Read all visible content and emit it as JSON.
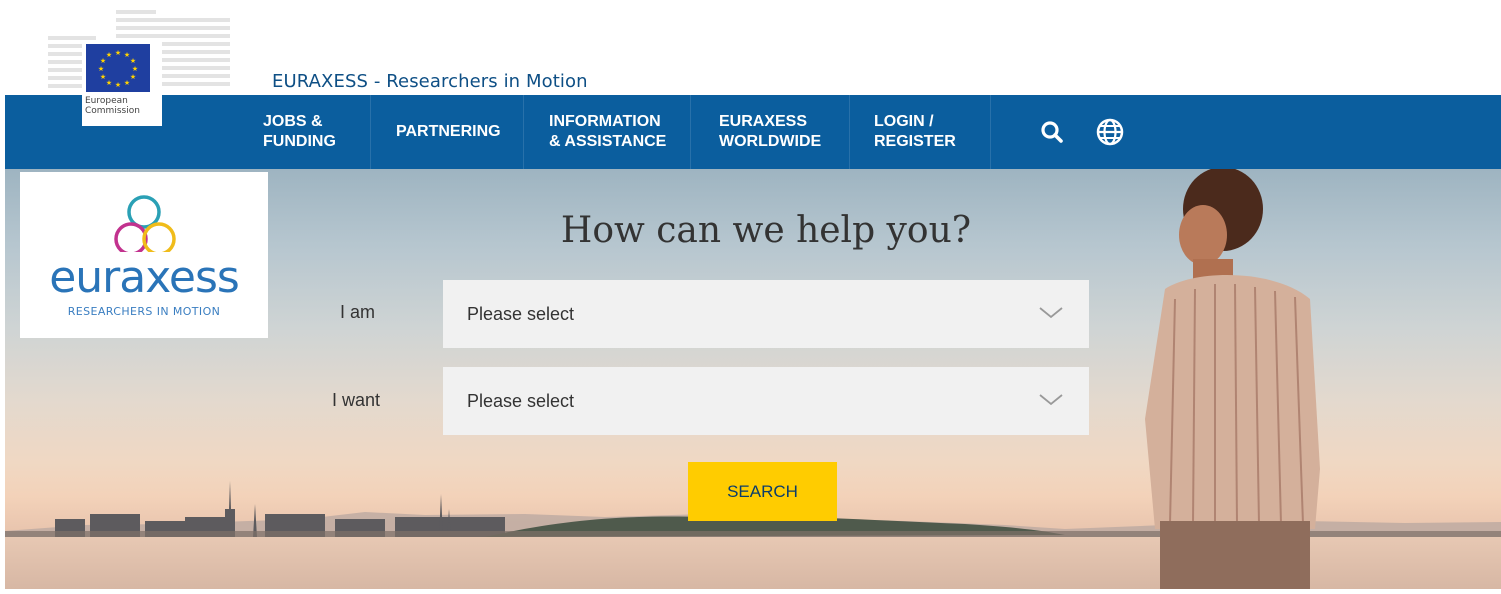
{
  "header": {
    "org_name_line1": "European",
    "org_name_line2": "Commission",
    "site_title": "EURAXESS - Researchers in Motion"
  },
  "nav": {
    "items": [
      {
        "line1": "JOBS &",
        "line2": "FUNDING"
      },
      {
        "line1": "PARTNERING",
        "line2": ""
      },
      {
        "line1": "INFORMATION",
        "line2": "& ASSISTANCE"
      },
      {
        "line1": "EURAXESS",
        "line2": "WORLDWIDE"
      },
      {
        "line1": "LOGIN /",
        "line2": "REGISTER"
      }
    ],
    "icons": [
      "search-icon",
      "globe-icon"
    ]
  },
  "logo": {
    "word": "euraxess",
    "tagline": "RESEARCHERS IN MOTION"
  },
  "hero": {
    "heading": "How can we help you?",
    "form": {
      "i_am_label": "I am",
      "i_am_value": "Please select",
      "i_want_label": "I want",
      "i_want_value": "Please select",
      "search_label": "SEARCH"
    }
  },
  "colors": {
    "nav_bg": "#0b5e9e",
    "search_button": "#ffcc00",
    "title_text": "#0e4f85"
  }
}
